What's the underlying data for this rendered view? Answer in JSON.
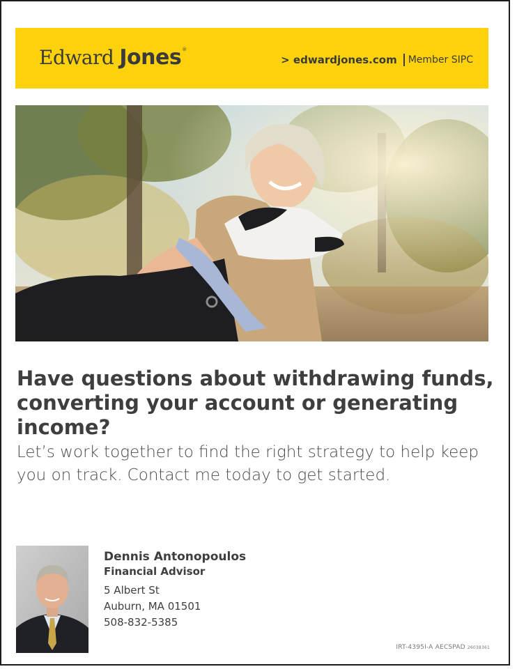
{
  "brand": {
    "logo_word_1": "Edward",
    "logo_word_2": "Jones",
    "logo_mark": "®",
    "website": "> edwardjones.com",
    "member": "Member SIPC",
    "color": "#fdd20c"
  },
  "hero_image": {
    "icon": "woman-hugging-dog-photo"
  },
  "headline": "Have questions about withdrawing funds, converting your account or generating income?",
  "body": "Let’s work together to find the right strategy to help keep you on track. Contact me today to get started.",
  "advisor": {
    "name": "Dennis Antonopoulos",
    "title": "Financial Advisor",
    "street": "5 Albert St",
    "city_state_zip": "Auburn, MA 01501",
    "phone": "508-832-5385",
    "photo_icon": "advisor-headshot"
  },
  "fine_print": {
    "code": "IRT-4395I-A AECSPAD",
    "number": "26038361"
  }
}
